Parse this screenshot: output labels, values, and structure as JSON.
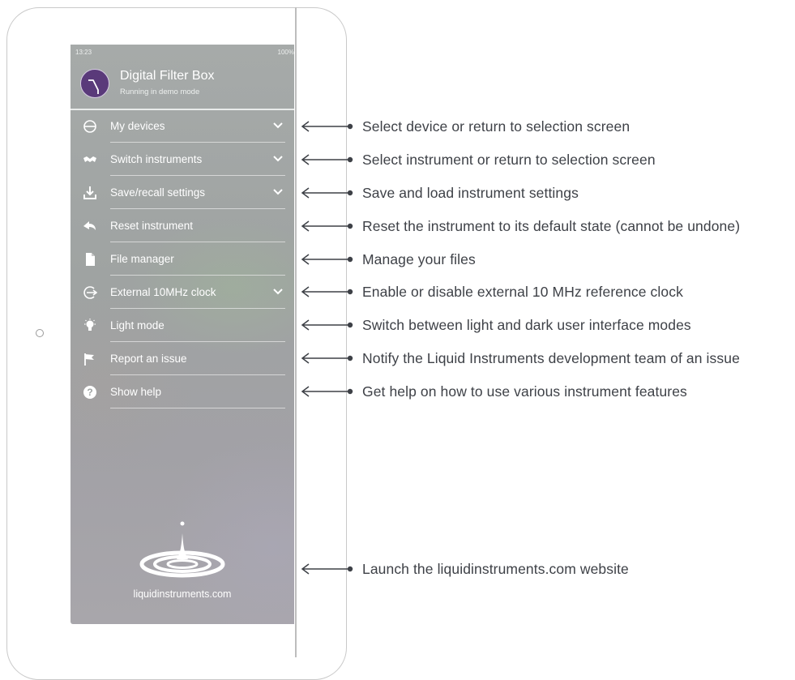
{
  "status_bar": {
    "time": "13:23",
    "battery": "100%"
  },
  "app": {
    "title": "Digital Filter Box",
    "subtitle": "Running in demo mode"
  },
  "menu": {
    "items": [
      {
        "label": "My devices",
        "icon": "device-icon",
        "chevron": true
      },
      {
        "label": "Switch instruments",
        "icon": "switch-instruments-icon",
        "chevron": true
      },
      {
        "label": "Save/recall settings",
        "icon": "download-icon",
        "chevron": true
      },
      {
        "label": "Reset instrument",
        "icon": "reset-arrow-icon",
        "chevron": false
      },
      {
        "label": "File manager",
        "icon": "file-icon",
        "chevron": false
      },
      {
        "label": "External 10MHz clock",
        "icon": "external-clock-icon",
        "chevron": true
      },
      {
        "label": "Light mode",
        "icon": "lightbulb-icon",
        "chevron": false
      },
      {
        "label": "Report an issue",
        "icon": "flag-icon",
        "chevron": false
      },
      {
        "label": "Show help",
        "icon": "help-icon",
        "chevron": false
      }
    ]
  },
  "footer": {
    "link": "liquidinstruments.com"
  },
  "annotations": [
    "Select device or return to selection screen",
    "Select instrument or return to selection screen",
    "Save and load instrument settings",
    "Reset the instrument to its default state (cannot be undone)",
    "Manage your files",
    "Enable or disable external 10 MHz reference clock",
    "Switch between light and dark user interface modes",
    "Notify the Liquid Instruments development team of an issue",
    "Get help on how to use various instrument features",
    "Launch the liquidinstruments.com website"
  ],
  "colors": {
    "annotation_text": "#3e4147",
    "panel_text": "#ffffff",
    "logo_bg": "#5a3a7a"
  }
}
